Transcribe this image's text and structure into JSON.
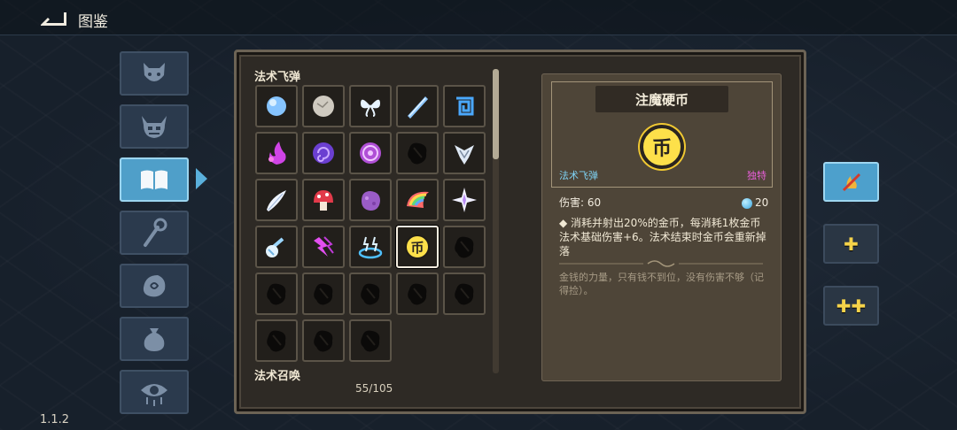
{
  "header": {
    "title": "图鉴"
  },
  "version": "1.1.2",
  "tabs": [
    {
      "icon": "demon-face-icon",
      "active": false
    },
    {
      "icon": "horned-skull-icon",
      "active": false
    },
    {
      "icon": "book-icon",
      "active": true
    },
    {
      "icon": "staff-icon",
      "active": false
    },
    {
      "icon": "rune-stone-icon",
      "active": false
    },
    {
      "icon": "pouch-icon",
      "active": false
    },
    {
      "icon": "eye-icon",
      "active": false
    }
  ],
  "spell_section": {
    "title": "法术飞弹"
  },
  "summon_section": {
    "title": "法术召唤"
  },
  "counter": "55/105",
  "spells": [
    {
      "icon": "blue-orb-icon",
      "known": true
    },
    {
      "icon": "stone-icon",
      "known": true
    },
    {
      "icon": "butterfly-icon",
      "known": true
    },
    {
      "icon": "ice-shard-icon",
      "known": true
    },
    {
      "icon": "spiral-rune-icon",
      "known": true
    },
    {
      "icon": "purple-flame-icon",
      "known": true
    },
    {
      "icon": "vortex-icon",
      "known": true
    },
    {
      "icon": "magic-circle-icon",
      "known": true
    },
    {
      "icon": "unknown-spell-icon",
      "known": false
    },
    {
      "icon": "serpent-icon",
      "known": true
    },
    {
      "icon": "feather-blade-icon",
      "known": true
    },
    {
      "icon": "red-mushroom-icon",
      "known": true
    },
    {
      "icon": "purple-rock-icon",
      "known": true
    },
    {
      "icon": "rainbow-wing-icon",
      "known": true
    },
    {
      "icon": "sparkle-star-icon",
      "known": true
    },
    {
      "icon": "meteor-icon",
      "known": true
    },
    {
      "icon": "lightning-burst-icon",
      "known": true
    },
    {
      "icon": "thunder-ring-icon",
      "known": true
    },
    {
      "icon": "coin-icon",
      "known": true,
      "selected": true
    },
    {
      "icon": "unknown-spell-icon",
      "known": false
    },
    {
      "icon": "unknown-spell-icon",
      "known": false
    },
    {
      "icon": "unknown-spell-icon",
      "known": false
    },
    {
      "icon": "unknown-spell-icon",
      "known": false
    },
    {
      "icon": "unknown-spell-icon",
      "known": false
    },
    {
      "icon": "unknown-spell-icon",
      "known": false
    },
    {
      "icon": "unknown-spell-icon",
      "known": false
    },
    {
      "icon": "unknown-spell-icon",
      "known": false
    },
    {
      "icon": "unknown-spell-icon",
      "known": false
    }
  ],
  "detail": {
    "title": "注魔硬币",
    "coin_glyph": "币",
    "category": "法术飞弹",
    "rarity": "独特",
    "damage_label": "伤害: 60",
    "mana": "20",
    "description": "◆ 消耗并射出20%的金币，每消耗1枚金币法术基础伤害+6。法术结束时金币会重新掉落",
    "flavor": "金钱的力量，只有钱不到位，没有伤害不够（记得捡）。"
  },
  "right_buttons": [
    {
      "icon": "no-fire-icon",
      "style": "blue"
    },
    {
      "label": "✚",
      "style": "dark"
    },
    {
      "label": "✚✚",
      "style": "dark"
    }
  ],
  "colors": {
    "accent": "#4f9fc9",
    "panel": "#2e2a25",
    "gold": "#fde04a",
    "rarity": "#e55fd6",
    "category": "#7fd3f5"
  }
}
